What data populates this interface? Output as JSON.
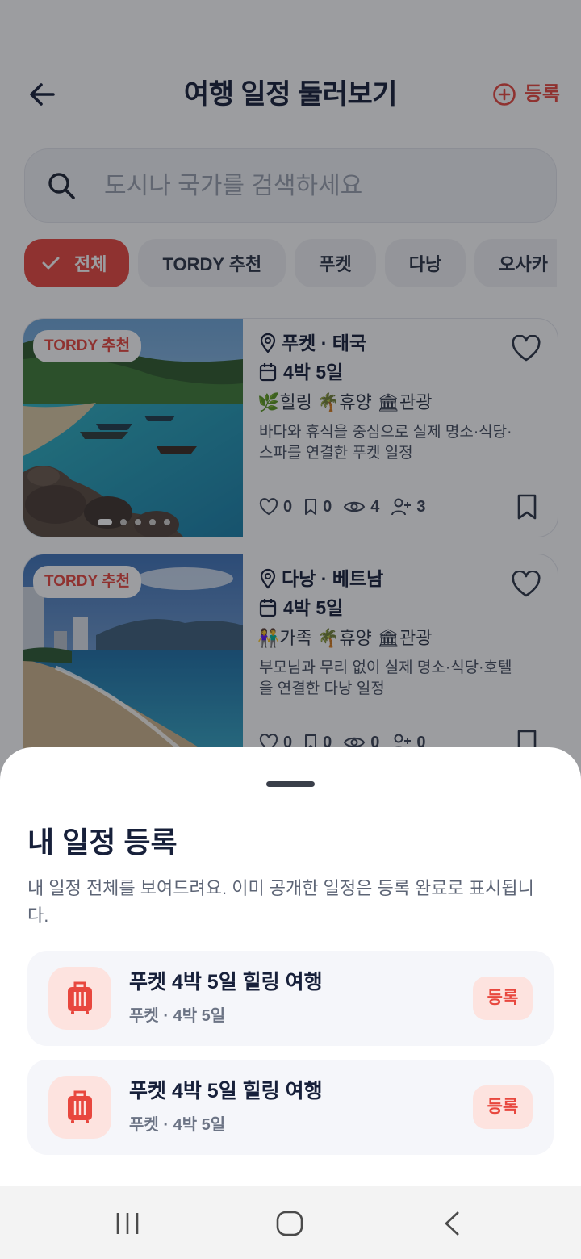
{
  "header": {
    "title": "여행 일정 둘러보기",
    "register_label": "등록"
  },
  "search": {
    "placeholder": "도시나 국가를 검색하세요"
  },
  "chips": [
    {
      "label": "전체",
      "active": true
    },
    {
      "label": "TORDY 추천"
    },
    {
      "label": "푸켓"
    },
    {
      "label": "다낭"
    },
    {
      "label": "오사카"
    }
  ],
  "cards": [
    {
      "badge": "TORDY 추천",
      "location": "푸켓 · 태국",
      "duration": "4박 5일",
      "tags": [
        {
          "emoji": "🌿",
          "label": "힐링"
        },
        {
          "emoji": "🌴",
          "label": "휴양"
        },
        {
          "emoji": "🏛",
          "label": "관광"
        }
      ],
      "description": "바다와 휴식을 중심으로 실제 명소·식당·스파를 연결한 푸켓 일정",
      "likes": "0",
      "saves": "0",
      "views": "4",
      "followers": "3"
    },
    {
      "badge": "TORDY 추천",
      "location": "다낭 · 베트남",
      "duration": "4박 5일",
      "tags": [
        {
          "emoji": "👫",
          "label": "가족"
        },
        {
          "emoji": "🌴",
          "label": "휴양"
        },
        {
          "emoji": "🏛",
          "label": "관광"
        }
      ],
      "description": "부모님과 무리 없이 실제 명소·식당·호텔을 연결한 다낭 일정",
      "likes": "0",
      "saves": "0",
      "views": "0",
      "followers": "0"
    }
  ],
  "sheet": {
    "title": "내 일정 등록",
    "description": "내 일정 전체를 보여드려요. 이미 공개한 일정은 등록 완료로 표시됩니다.",
    "items": [
      {
        "name": "푸켓 4박 5일 힐링 여행",
        "meta": "푸켓 · 4박 5일",
        "button": "등록"
      },
      {
        "name": "푸켓 4박 5일 힐링 여행",
        "meta": "푸켓 · 4박 5일",
        "button": "등록"
      }
    ]
  },
  "colors": {
    "accent": "#e8473e",
    "accent_soft": "#fde3df",
    "title": "#17203a"
  },
  "icons": [
    "back-arrow-icon",
    "add-circle-icon",
    "search-icon",
    "check-icon",
    "pin-icon",
    "calendar-icon",
    "heart-icon",
    "bookmark-icon",
    "eye-icon",
    "person-add-icon",
    "suitcase-icon",
    "recent-apps-icon",
    "home-icon",
    "back-nav-icon"
  ]
}
